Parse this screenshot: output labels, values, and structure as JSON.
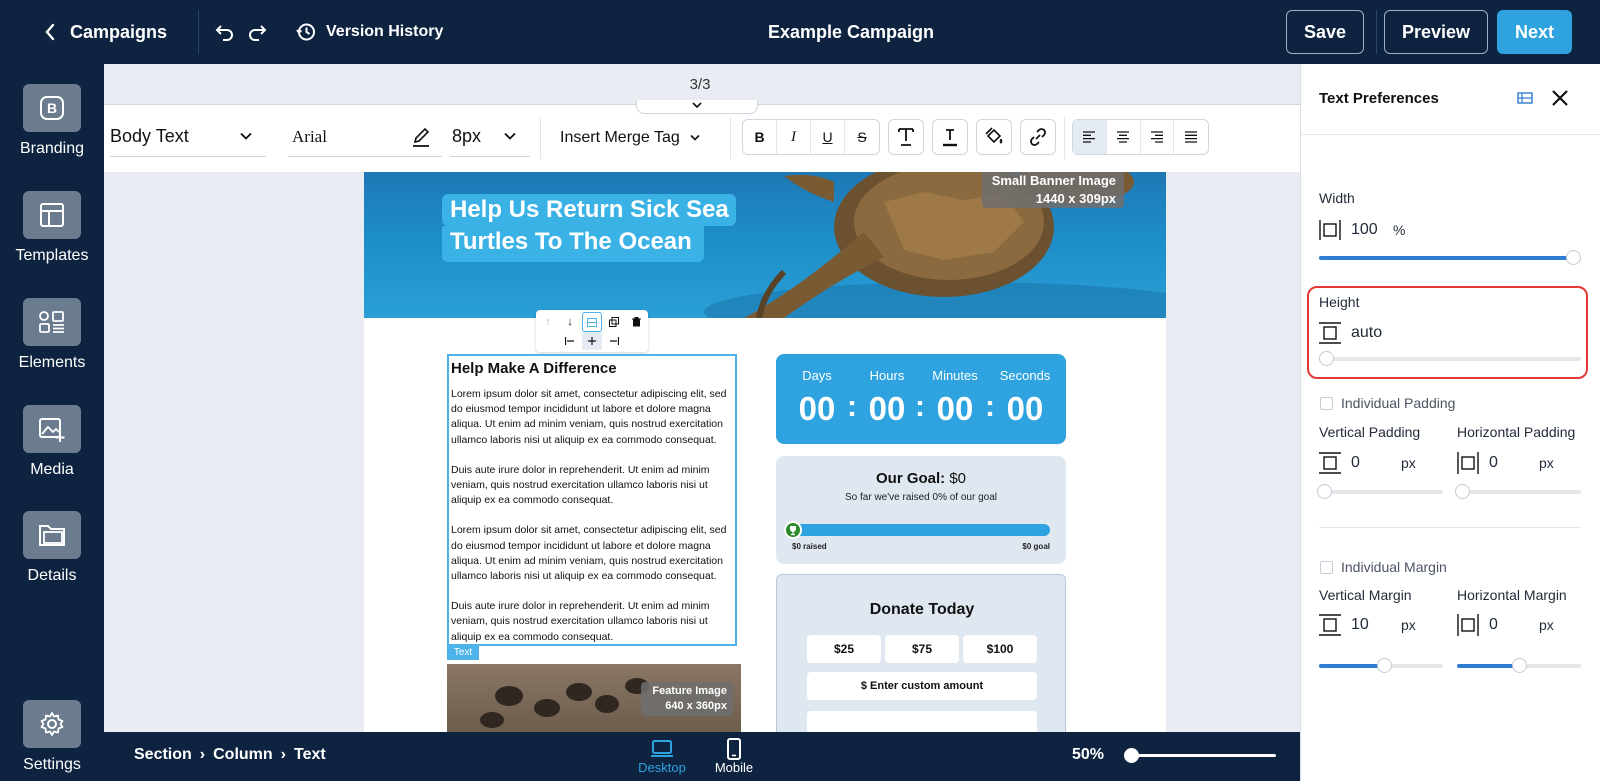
{
  "topbar": {
    "back_label": "Campaigns",
    "version_history": "Version History",
    "campaign_title": "Example Campaign",
    "save_label": "Save",
    "preview_label": "Preview",
    "next_label": "Next"
  },
  "sidebar": {
    "items": [
      {
        "label": "Branding",
        "icon": "branding-icon"
      },
      {
        "label": "Templates",
        "icon": "templates-icon"
      },
      {
        "label": "Elements",
        "icon": "elements-icon"
      },
      {
        "label": "Media",
        "icon": "media-icon"
      },
      {
        "label": "Details",
        "icon": "details-icon"
      }
    ],
    "settings_label": "Settings"
  },
  "canvas": {
    "page_indicator": "3/3"
  },
  "toolbar": {
    "style_select": "Body Text",
    "font_select": "Arial",
    "size_select": "8px",
    "merge_tag": "Insert Merge Tag",
    "bold": "B",
    "italic": "I",
    "underline": "U",
    "strike": "S"
  },
  "email": {
    "banner_title_line1": "Help Us Return Sick Sea",
    "banner_title_line2": "Turtles To The Ocean",
    "banner_badge_line1": "Small Banner Image",
    "banner_badge_line2": "1440 x 309px",
    "text_heading": "Help Make A Difference",
    "paragraphs": [
      "Lorem ipsum dolor sit amet, consectetur adipiscing elit, sed do eiusmod tempor incididunt ut labore et dolore magna aliqua. Ut enim ad minim veniam, quis nostrud exercitation ullamco laboris nisi ut aliquip ex ea commodo consequat.",
      "Duis aute irure dolor in reprehenderit. Ut enim ad minim veniam, quis nostrud exercitation ullamco laboris nisi ut aliquip ex ea commodo consequat.",
      "Lorem ipsum dolor sit amet, consectetur adipiscing elit, sed do eiusmod tempor incididunt ut labore et dolore magna aliqua. Ut enim ad minim veniam, quis nostrud exercitation ullamco laboris nisi ut aliquip ex ea commodo consequat.",
      "Duis aute irure dolor in reprehenderit. Ut enim ad minim veniam, quis nostrud exercitation ullamco laboris nisi ut aliquip ex ea commodo consequat."
    ],
    "text_tag": "Text",
    "feature_badge_line1": "Feature Image",
    "feature_badge_line2": "640 x 360px",
    "timer": {
      "labels": [
        "Days",
        "Hours",
        "Minutes",
        "Seconds"
      ],
      "values": [
        "00",
        "00",
        "00",
        "00"
      ],
      "sep": ":"
    },
    "goal": {
      "title": "Our Goal:",
      "amount": "$0",
      "subtitle": "So far we've raised 0% of our goal",
      "raised_label": "$0 raised",
      "goal_label": "$0 goal",
      "progress_fraction": 0
    },
    "donate": {
      "title": "Donate Today",
      "amounts": [
        "$25",
        "$75",
        "$100"
      ],
      "custom": "$ Enter custom amount"
    }
  },
  "panel": {
    "title": "Text Preferences",
    "width_label": "Width",
    "width_value": "100",
    "width_unit": "%",
    "width_level": 1.0,
    "height_label": "Height",
    "height_value": "auto",
    "height_level": 0,
    "individual_padding": "Individual Padding",
    "vertical_padding_label": "Vertical Padding",
    "vertical_padding_value": "0",
    "horizontal_padding_label": "Horizontal Padding",
    "horizontal_padding_value": "0",
    "individual_margin": "Individual Margin",
    "vertical_margin_label": "Vertical Margin",
    "vertical_margin_value": "10",
    "horizontal_margin_label": "Horizontal Margin",
    "horizontal_margin_value": "0",
    "unit_px": "px",
    "highlight_color": "#e53935"
  },
  "bottombar": {
    "breadcrumb": [
      "Section",
      "Column",
      "Text"
    ],
    "breadcrumb_sep": "›",
    "desktop_label": "Desktop",
    "mobile_label": "Mobile",
    "zoom": "50%",
    "zoom_level": 0.0
  },
  "colors": {
    "navy": "#0d2340",
    "accent": "#2ea3df",
    "selection": "#4db3ea"
  }
}
